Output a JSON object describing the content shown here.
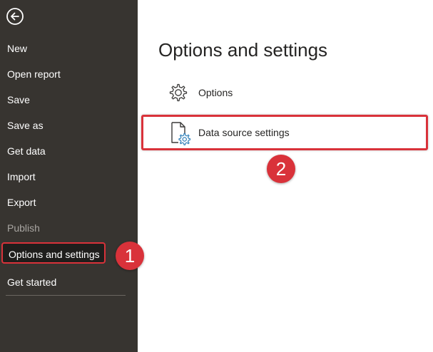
{
  "sidebar": {
    "back_icon": "back-arrow-circle-icon",
    "items": [
      {
        "label": "New",
        "state": "normal"
      },
      {
        "label": "Open report",
        "state": "normal"
      },
      {
        "label": "Save",
        "state": "normal"
      },
      {
        "label": "Save as",
        "state": "normal"
      },
      {
        "label": "Get data",
        "state": "normal"
      },
      {
        "label": "Import",
        "state": "normal"
      },
      {
        "label": "Export",
        "state": "normal"
      },
      {
        "label": "Publish",
        "state": "disabled"
      },
      {
        "label": "Options and settings",
        "state": "selected"
      },
      {
        "label": "Get started",
        "state": "normal"
      }
    ]
  },
  "main": {
    "title": "Options and settings",
    "options": [
      {
        "label": "Options",
        "icon": "gear-icon"
      },
      {
        "label": "Data source settings",
        "icon": "document-gear-icon"
      }
    ]
  },
  "callouts": [
    {
      "number": "1"
    },
    {
      "number": "2"
    }
  ],
  "colors": {
    "sidebar_bg": "#373430",
    "highlight": "#d9323a",
    "accent_gear": "#2f7fb8"
  }
}
